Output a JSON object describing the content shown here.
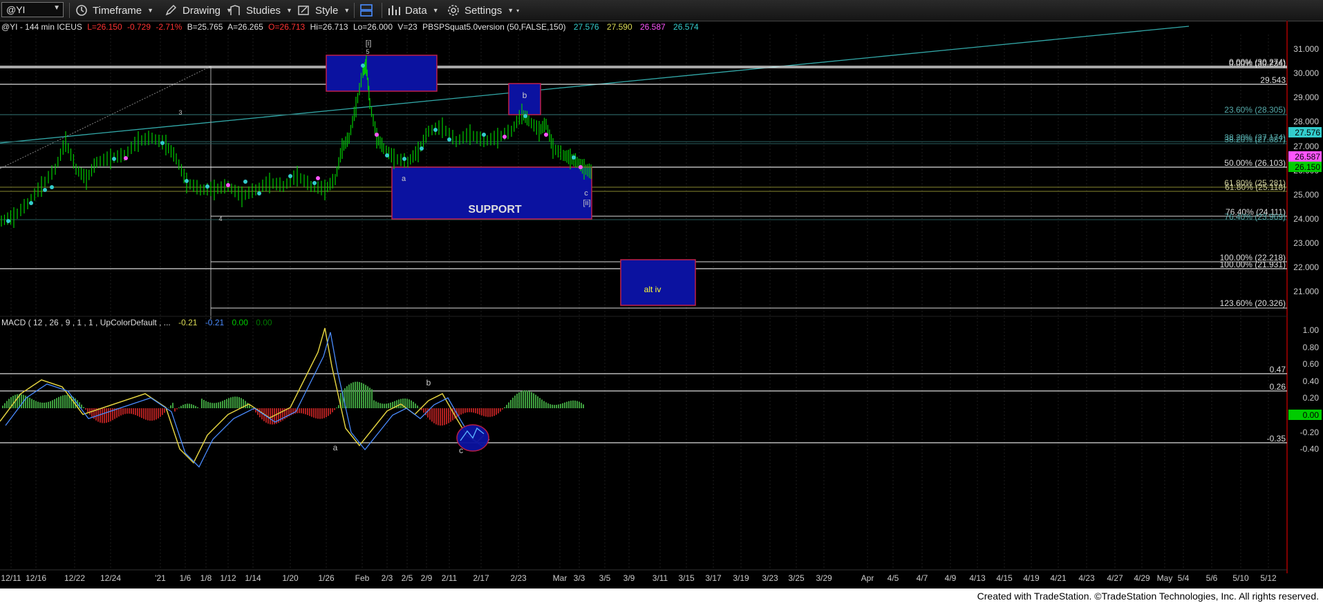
{
  "toolbar": {
    "symbol": "@YI",
    "timeframe": "Timeframe",
    "drawing": "Drawing",
    "studies": "Studies",
    "style": "Style",
    "data": "Data",
    "settings": "Settings"
  },
  "header": {
    "prefix": "@YI - 144 min  ICEUS",
    "last": "L=26.150",
    "change": "-0.729",
    "change_pct": "-2.71%",
    "bid": "B=25.765",
    "ask": "A=26.265",
    "open": "O=26.713",
    "high": "Hi=26.713",
    "low": "Lo=26.000",
    "volume": "V=23",
    "study": "PBSPSquat5.0version (50,FALSE,150)",
    "study_values": [
      "27.576",
      "27.590",
      "26.587",
      "26.574"
    ],
    "colors": {
      "green": "#00cc00",
      "red": "#ff3333",
      "cyan": "#33cccc",
      "yellow": "#dddd55",
      "magenta": "#ff55ff",
      "white": "#e0e0e0"
    }
  },
  "price_axis": {
    "ticks": [
      "31.000",
      "30.000",
      "29.000",
      "28.000",
      "27.000",
      "26.000",
      "25.000",
      "24.000",
      "23.000",
      "22.000",
      "21.000"
    ],
    "badges": [
      {
        "label": "27.576",
        "bg": "#33cccc",
        "fg": "#000000"
      },
      {
        "label": "26.587",
        "bg": "#ff55ff",
        "fg": "#000000"
      },
      {
        "label": "26.150",
        "bg": "#00cc00",
        "fg": "#000000"
      }
    ]
  },
  "levels": [
    {
      "label": "0.00% (30.274)"
    },
    {
      "label": "0.00% (30.234)"
    },
    {
      "label": "29.543"
    },
    {
      "label": "23.60% (28.305)"
    },
    {
      "label": "38.20% (27.174)"
    },
    {
      "label": "38.20% (27.087)"
    },
    {
      "label": "50.00% (26.103)"
    },
    {
      "label": "61.80% (25.281)"
    },
    {
      "label": "61.80% (25.118)"
    },
    {
      "label": "76.40% (24.111)"
    },
    {
      "label": "76.40% (23.969)"
    },
    {
      "label": "100.00% (22.218)"
    },
    {
      "label": "100.00% (21.931)"
    },
    {
      "label": "123.60% (20.326)"
    }
  ],
  "boxes": {
    "support_label": "SUPPORT",
    "alt_label": "alt iv",
    "b_label": "b"
  },
  "wave_labels": {
    "top": "[i]",
    "top_sub": "5",
    "three": "3",
    "four": "4",
    "a": "a",
    "c": "c",
    "ii": "[ii]"
  },
  "macd": {
    "title": "MACD ( 12 , 26 , 9 , 1 , 1 , UpColorDefault , ...",
    "values": [
      "-0.21",
      "-0.21",
      "0.00",
      "0.00"
    ],
    "ticks": [
      "1.00",
      "0.80",
      "0.60",
      "0.40",
      "0.20",
      "0.00",
      "-0.20",
      "-0.40"
    ],
    "badge": "0.00",
    "levels": [
      "0.47",
      "0.26",
      "-0.35"
    ],
    "labels": {
      "b": "b",
      "a": "a",
      "c": "c"
    }
  },
  "time_axis": [
    "12/11",
    "12/16",
    "12/22",
    "12/24",
    "'21",
    "1/6",
    "1/8",
    "1/12",
    "1/14",
    "1/20",
    "1/26",
    "Feb",
    "2/3",
    "2/5",
    "2/9",
    "2/11",
    "2/17",
    "2/23",
    "Mar",
    "3/3",
    "3/5",
    "3/9",
    "3/11",
    "3/15",
    "3/17",
    "3/19",
    "3/23",
    "3/25",
    "3/29",
    "Apr",
    "4/5",
    "4/7",
    "4/9",
    "4/13",
    "4/15",
    "4/19",
    "4/21",
    "4/23",
    "4/27",
    "4/29",
    "May",
    "5/4",
    "5/6",
    "5/10",
    "5/12"
  ],
  "footer": "Created with TradeStation. ©TradeStation Technologies, Inc. All rights reserved."
}
